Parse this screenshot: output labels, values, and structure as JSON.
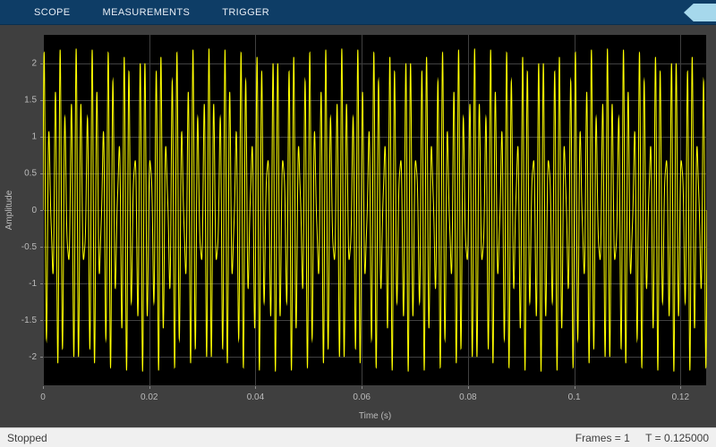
{
  "toolbar": {
    "tabs": [
      {
        "label": "SCOPE"
      },
      {
        "label": "MEASUREMENTS"
      },
      {
        "label": "TRIGGER"
      }
    ],
    "help_label": "?",
    "background_color": "#0e3d66"
  },
  "chart_data": {
    "type": "line",
    "title": "",
    "xlabel": "Time (s)",
    "ylabel": "Amplitude",
    "xlim": [
      0,
      0.125
    ],
    "ylim": [
      -2.4,
      2.4
    ],
    "xticks": [
      0,
      0.02,
      0.04,
      0.06,
      0.08,
      0.1,
      0.12
    ],
    "xtick_labels": [
      "0",
      "0.02",
      "0.04",
      "0.06",
      "0.08",
      "0.1",
      "0.12"
    ],
    "yticks": [
      2,
      1.5,
      1,
      0.5,
      0,
      -0.5,
      -1,
      -1.5,
      -2
    ],
    "ytick_labels": [
      "2",
      "1.5",
      "1",
      "0.5",
      "0",
      "-0.5",
      "-1",
      "-1.5",
      "-2"
    ],
    "grid": true,
    "legend": "none",
    "line_color": "#ffff00",
    "background": "#000000",
    "panel_bg": "#3f3f3f",
    "grid_color": "#404040",
    "tick_color": "#bcbcbc",
    "label_color": "#bcbcbc",
    "signal": {
      "description": "dense two-tone sinusoid sum with ~40 beat clusters over 0.125 s, peak amplitude ~2.2",
      "components": [
        {
          "amplitude": 1.4,
          "frequency_hz": 1000
        },
        {
          "amplitude": 0.8,
          "frequency_hz": 1320
        }
      ],
      "duration_s": 0.125,
      "samples": 6000
    }
  },
  "status_bar": {
    "left": "Stopped",
    "frames": "Frames = 1",
    "time": "T = 0.125000"
  }
}
